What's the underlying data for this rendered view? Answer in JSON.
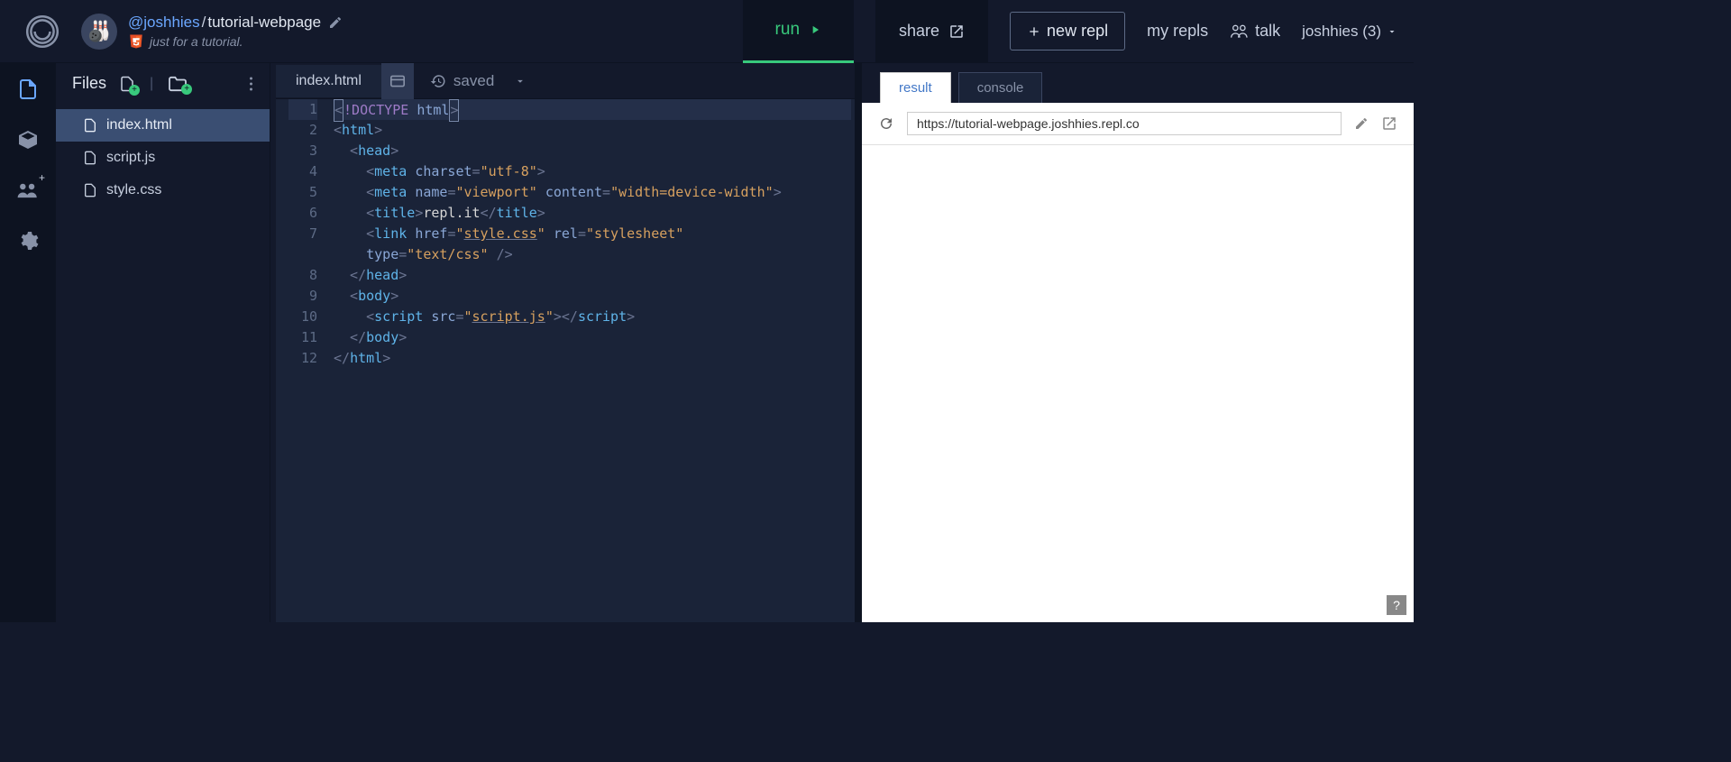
{
  "header": {
    "username": "@joshhies",
    "separator": "/",
    "project": "tutorial-webpage",
    "description": "just for a tutorial.",
    "run_label": "run",
    "share_label": "share",
    "new_repl_label": "new repl",
    "my_repls_label": "my repls",
    "talk_label": "talk",
    "user_menu": "joshhies (3)"
  },
  "files_panel": {
    "title": "Files",
    "items": [
      {
        "name": "index.html",
        "active": true
      },
      {
        "name": "script.js",
        "active": false
      },
      {
        "name": "style.css",
        "active": false
      }
    ]
  },
  "editor": {
    "tab_name": "index.html",
    "saved_label": "saved",
    "line_count": 12,
    "code_tokens": [
      [
        {
          "c": "p",
          "t": "<"
        },
        {
          "c": "k",
          "t": "!DOCTYPE "
        },
        {
          "c": "a",
          "t": "html"
        },
        {
          "c": "p",
          "t": ">"
        }
      ],
      [
        {
          "c": "p",
          "t": "<"
        },
        {
          "c": "t",
          "t": "html"
        },
        {
          "c": "p",
          "t": ">"
        }
      ],
      [
        {
          "c": "p",
          "t": "  <"
        },
        {
          "c": "t",
          "t": "head"
        },
        {
          "c": "p",
          "t": ">"
        }
      ],
      [
        {
          "c": "p",
          "t": "    <"
        },
        {
          "c": "t",
          "t": "meta"
        },
        {
          "c": "p",
          "t": " "
        },
        {
          "c": "a",
          "t": "charset"
        },
        {
          "c": "p",
          "t": "="
        },
        {
          "c": "s",
          "t": "\"utf-8\""
        },
        {
          "c": "p",
          "t": ">"
        }
      ],
      [
        {
          "c": "p",
          "t": "    <"
        },
        {
          "c": "t",
          "t": "meta"
        },
        {
          "c": "p",
          "t": " "
        },
        {
          "c": "a",
          "t": "name"
        },
        {
          "c": "p",
          "t": "="
        },
        {
          "c": "s",
          "t": "\"viewport\""
        },
        {
          "c": "p",
          "t": " "
        },
        {
          "c": "a",
          "t": "content"
        },
        {
          "c": "p",
          "t": "="
        },
        {
          "c": "s",
          "t": "\"width=device-width\""
        },
        {
          "c": "p",
          "t": ">"
        }
      ],
      [
        {
          "c": "p",
          "t": "    <"
        },
        {
          "c": "t",
          "t": "title"
        },
        {
          "c": "p",
          "t": ">"
        },
        {
          "c": "txt",
          "t": "repl.it"
        },
        {
          "c": "p",
          "t": "</"
        },
        {
          "c": "t",
          "t": "title"
        },
        {
          "c": "p",
          "t": ">"
        }
      ],
      [
        {
          "c": "p",
          "t": "    <"
        },
        {
          "c": "t",
          "t": "link"
        },
        {
          "c": "p",
          "t": " "
        },
        {
          "c": "a",
          "t": "href"
        },
        {
          "c": "p",
          "t": "="
        },
        {
          "c": "s",
          "t": "\""
        },
        {
          "c": "s ul",
          "t": "style.css"
        },
        {
          "c": "s",
          "t": "\""
        },
        {
          "c": "p",
          "t": " "
        },
        {
          "c": "a",
          "t": "rel"
        },
        {
          "c": "p",
          "t": "="
        },
        {
          "c": "s",
          "t": "\"stylesheet\""
        },
        {
          "c": "p",
          "t": " "
        }
      ],
      [
        {
          "c": "p",
          "t": "    "
        },
        {
          "c": "a",
          "t": "type"
        },
        {
          "c": "p",
          "t": "="
        },
        {
          "c": "s",
          "t": "\"text/css\""
        },
        {
          "c": "p",
          "t": " />"
        }
      ],
      [
        {
          "c": "p",
          "t": "  </"
        },
        {
          "c": "t",
          "t": "head"
        },
        {
          "c": "p",
          "t": ">"
        }
      ],
      [
        {
          "c": "p",
          "t": "  <"
        },
        {
          "c": "t",
          "t": "body"
        },
        {
          "c": "p",
          "t": ">"
        }
      ],
      [
        {
          "c": "p",
          "t": "    <"
        },
        {
          "c": "t",
          "t": "script"
        },
        {
          "c": "p",
          "t": " "
        },
        {
          "c": "a",
          "t": "src"
        },
        {
          "c": "p",
          "t": "="
        },
        {
          "c": "s",
          "t": "\""
        },
        {
          "c": "s ul",
          "t": "script.js"
        },
        {
          "c": "s",
          "t": "\""
        },
        {
          "c": "p",
          "t": "></"
        },
        {
          "c": "t",
          "t": "script"
        },
        {
          "c": "p",
          "t": ">"
        }
      ],
      [
        {
          "c": "p",
          "t": "  </"
        },
        {
          "c": "t",
          "t": "body"
        },
        {
          "c": "p",
          "t": ">"
        }
      ],
      [
        {
          "c": "p",
          "t": "</"
        },
        {
          "c": "t",
          "t": "html"
        },
        {
          "c": "p",
          "t": ">"
        }
      ]
    ],
    "gutter_numbers": [
      "1",
      "2",
      "3",
      "4",
      "5",
      "6",
      "7",
      "",
      "8",
      "9",
      "10",
      "11",
      "12"
    ]
  },
  "output": {
    "tabs": [
      {
        "label": "result",
        "active": true
      },
      {
        "label": "console",
        "active": false
      }
    ],
    "url": "https://tutorial-webpage.joshhies.repl.co",
    "help_label": "?"
  }
}
